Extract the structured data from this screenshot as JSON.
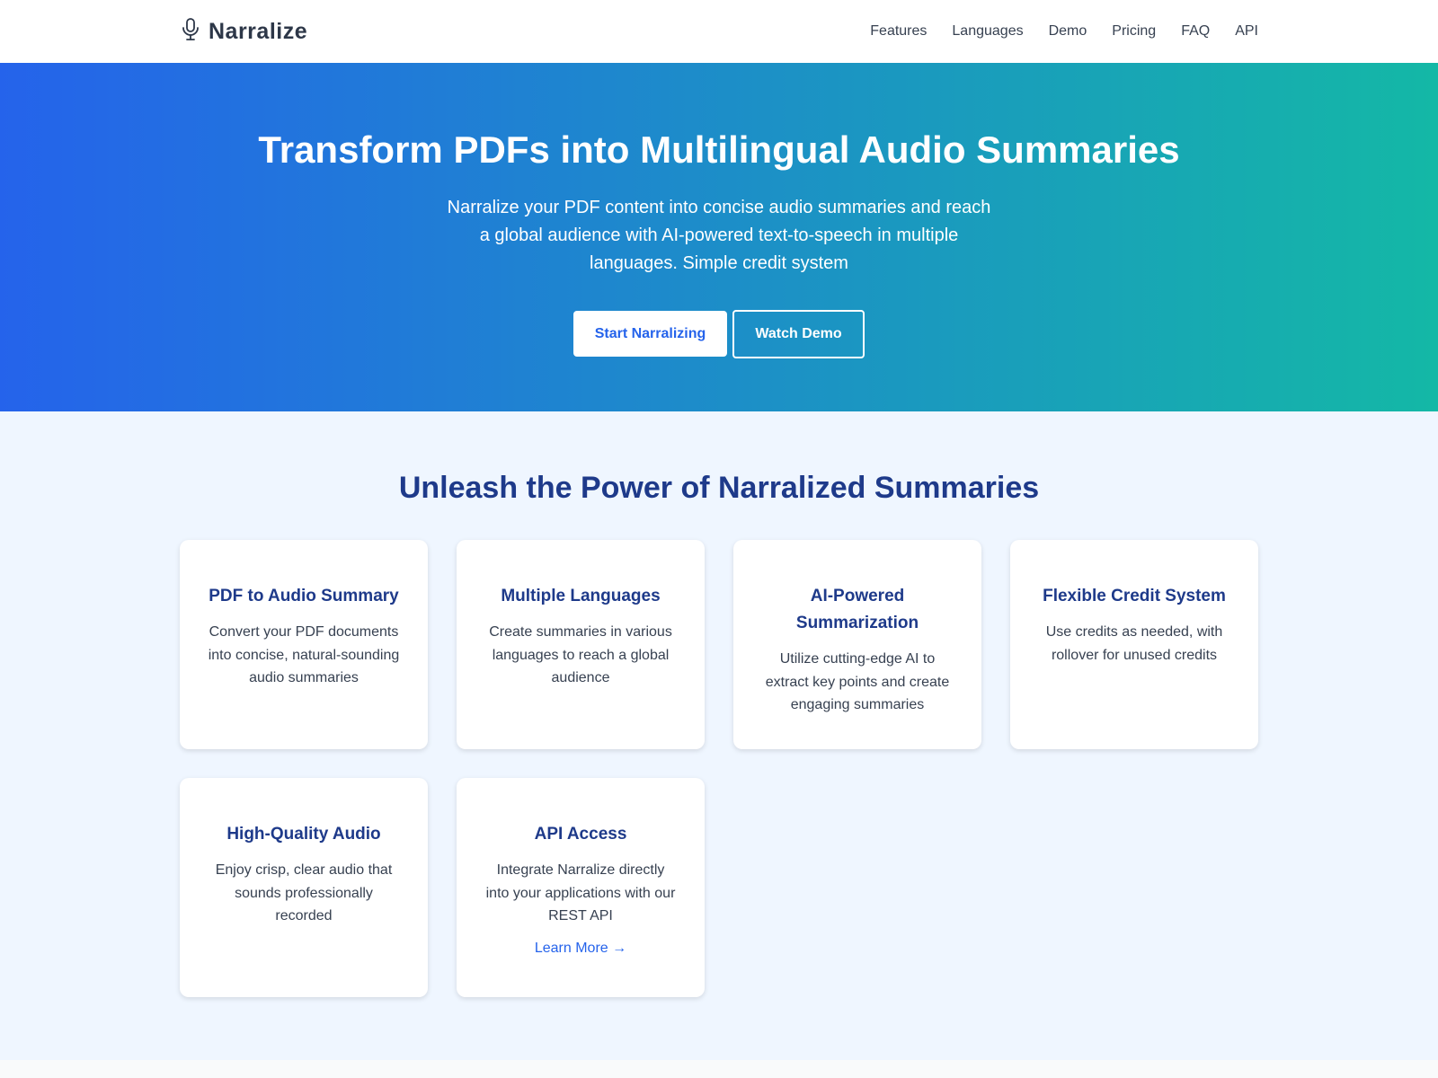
{
  "header": {
    "brand_name": "Narralize",
    "brand_icon": "microphone-icon",
    "nav": [
      {
        "label": "Features"
      },
      {
        "label": "Languages"
      },
      {
        "label": "Demo"
      },
      {
        "label": "Pricing"
      },
      {
        "label": "FAQ"
      },
      {
        "label": "API"
      }
    ]
  },
  "hero": {
    "title": "Transform PDFs into Multilingual Audio Summaries",
    "subtitle": "Narralize your PDF content into concise audio summaries and reach a global audience with AI-powered text-to-speech in multiple languages. Simple credit system",
    "primary_button": "Start Narralizing",
    "secondary_button": "Watch Demo",
    "gradient_start": "#2563eb",
    "gradient_end": "#14b8a6"
  },
  "features": {
    "title": "Unleash the Power of Narralized Summaries",
    "cards": [
      {
        "title": "PDF to Audio Summary",
        "description": "Convert your PDF documents into concise, natural-sounding audio summaries"
      },
      {
        "title": "Multiple Languages",
        "description": "Create summaries in various languages to reach a global audience"
      },
      {
        "title": "AI-Powered Summarization",
        "description": "Utilize cutting-edge AI to extract key points and create engaging summaries"
      },
      {
        "title": "Flexible Credit System",
        "description": "Use credits as needed, with rollover for unused credits"
      },
      {
        "title": "High-Quality Audio",
        "description": "Enjoy crisp, clear audio that sounds professionally recorded"
      },
      {
        "title": "API Access",
        "description": "Integrate Narralize directly into your applications with our REST API",
        "link": "Learn More →"
      }
    ]
  },
  "colors": {
    "heading": "#1e3a8a",
    "accent": "#2563eb",
    "features_bg": "#eff6ff"
  }
}
